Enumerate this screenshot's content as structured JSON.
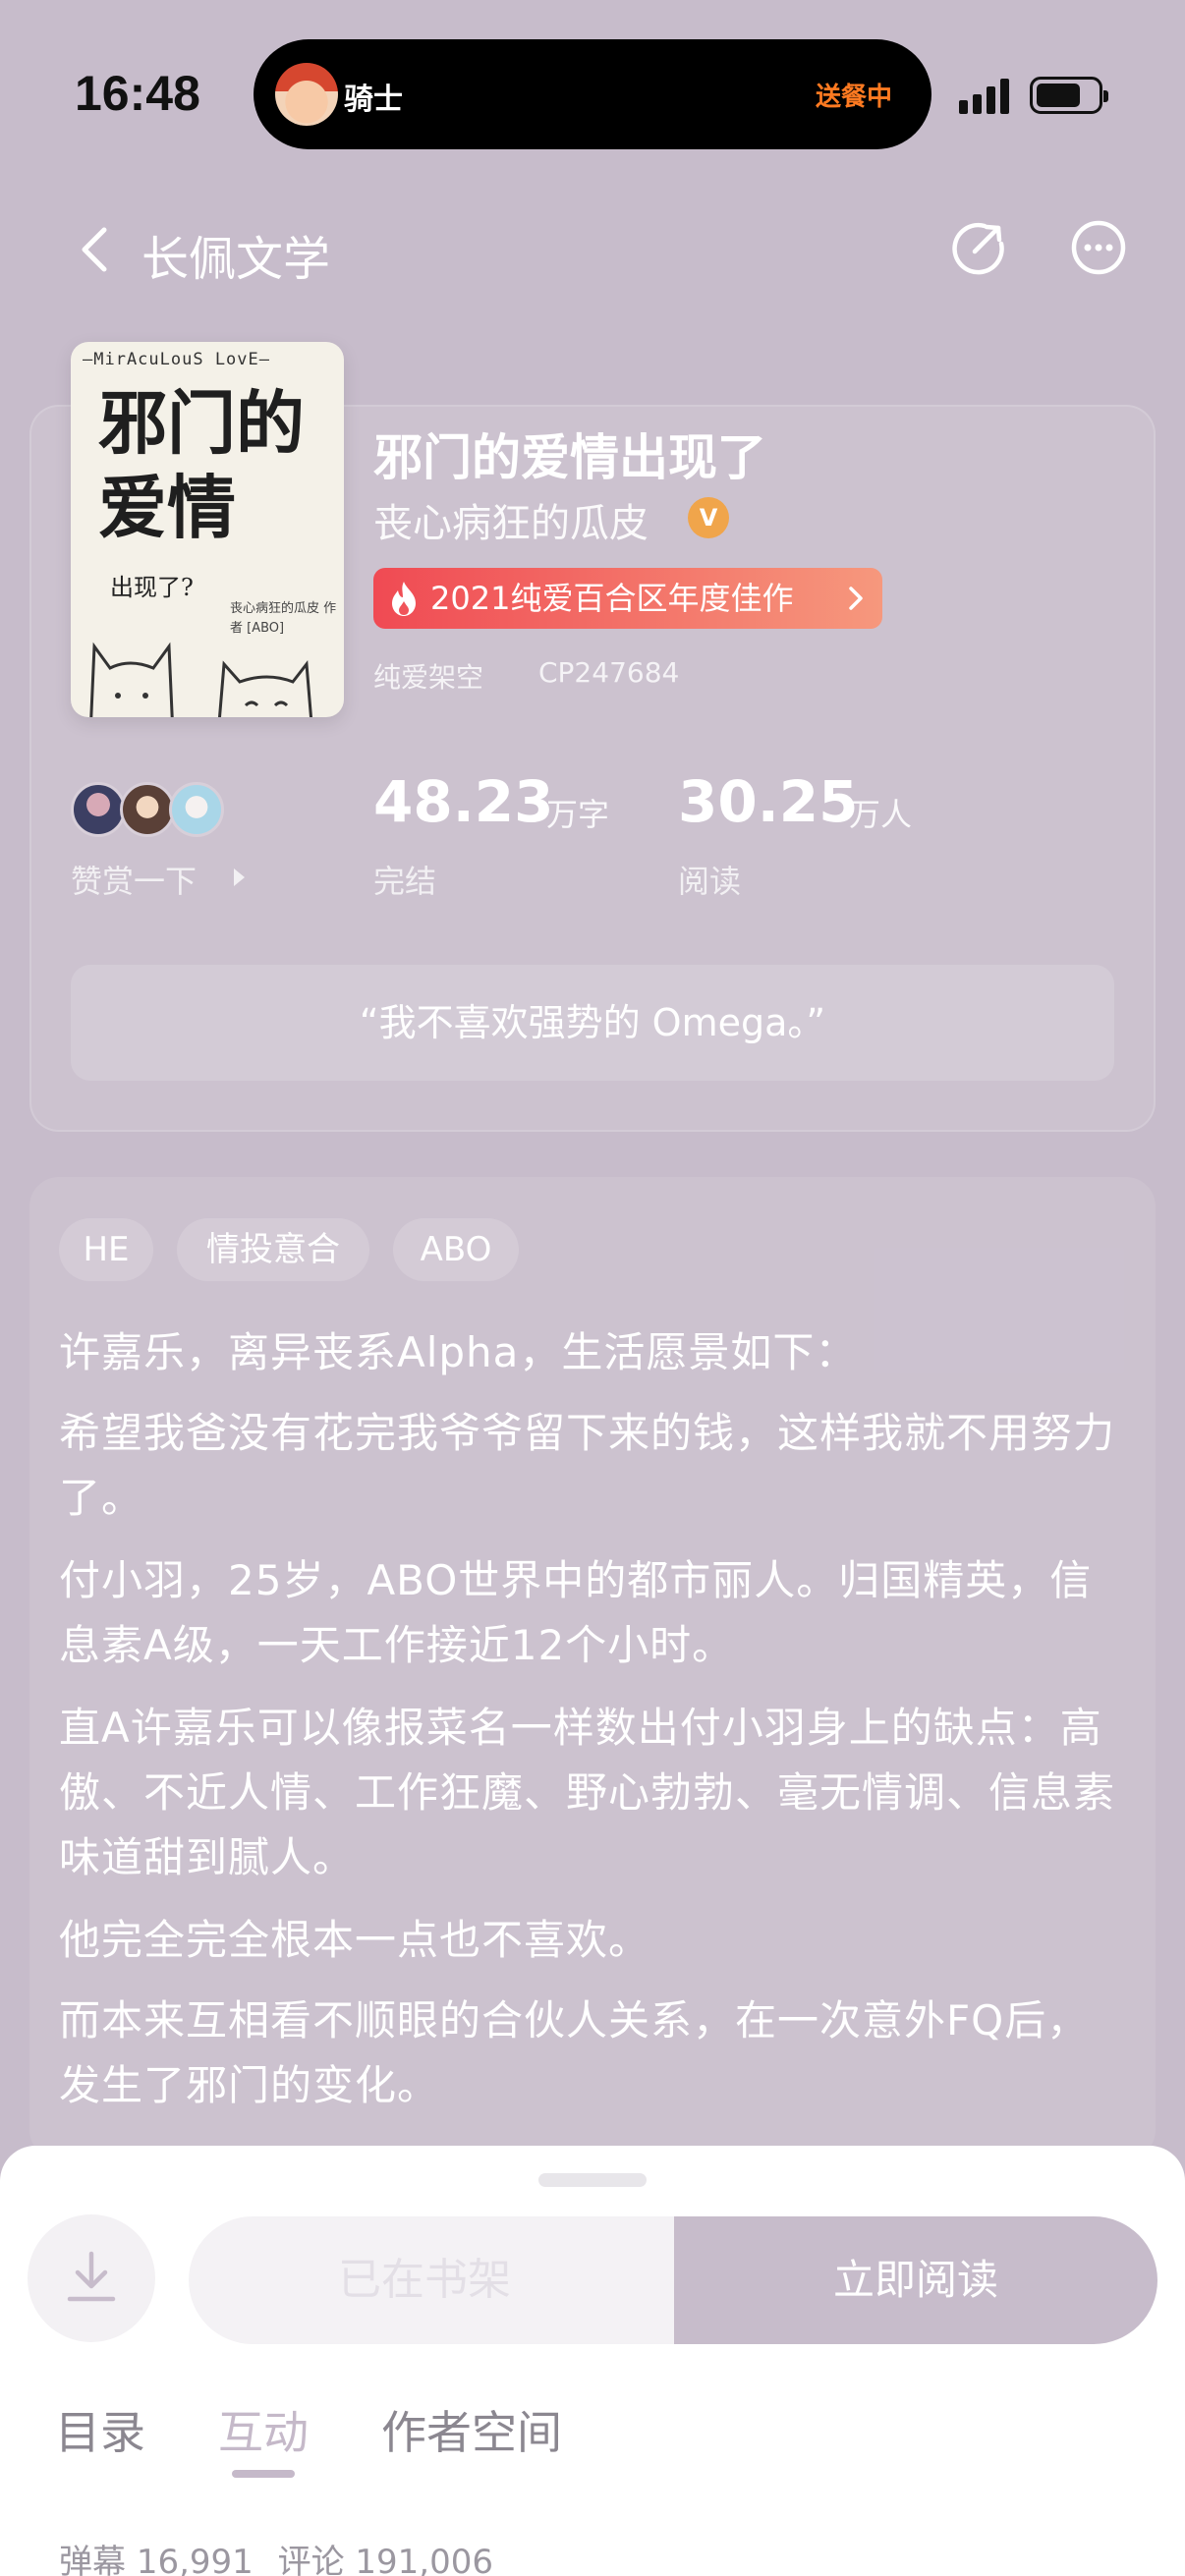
{
  "status_bar": {
    "time": "16:48",
    "rider_label": "骑士",
    "delivery_status": "送餐中"
  },
  "nav": {
    "title": "长佩文学"
  },
  "book": {
    "cover": {
      "top_text": "—MirAcuLouS  LovE—",
      "title": "邪门的爱情",
      "subtitle": "出现了?",
      "credit": "丧心病狂的瓜皮 作者 [ABO]"
    },
    "title": "邪门的爱情出现了",
    "author": "丧心病狂的瓜皮",
    "verified_badge": "V",
    "award": "2021纯爱百合区年度佳作",
    "category": "纯爱架空",
    "cp_id": "CP247684",
    "reward_label": "赞赏一下",
    "word_count": "48.23",
    "word_count_unit": "万字",
    "status_label": "完结",
    "readers": "30.25",
    "readers_unit": "万人",
    "readers_label": "阅读",
    "quote": "“我不喜欢强势的 Omega。”"
  },
  "intro": {
    "tags": [
      "HE",
      "情投意合",
      "ABO"
    ],
    "paragraphs": [
      "许嘉乐，离异丧系Alpha，生活愿景如下：",
      "希望我爸没有花完我爷爷留下来的钱，这样我就不用努力了。",
      "付小羽，25岁，ABO世界中的都市丽人。归国精英，信息素A级，一天工作接近12个小时。",
      "直A许嘉乐可以像报菜名一样数出付小羽身上的缺点：高傲、不近人情、工作狂魔、野心勃勃、毫无情调、信息素味道甜到腻人。",
      "他完全完全根本一点也不喜欢。",
      "而本来互相看不顺眼的合伙人关系，在一次意外FQ后，发生了邪门的变化。"
    ]
  },
  "bottom": {
    "shelf_label": "已在书架",
    "read_label": "立即阅读",
    "tabs": [
      "目录",
      "互动",
      "作者空间"
    ],
    "active_tab": "互动",
    "danmu_label": "弹幕",
    "danmu_count": "16,991",
    "comment_label": "评论",
    "comment_count": "191,006"
  },
  "colors": {
    "page_bg": "#c7bccb",
    "award_start": "#f04a53",
    "award_end": "#f6987d",
    "delivery_status": "#ff7a21",
    "read_button": "#c7bccb"
  }
}
